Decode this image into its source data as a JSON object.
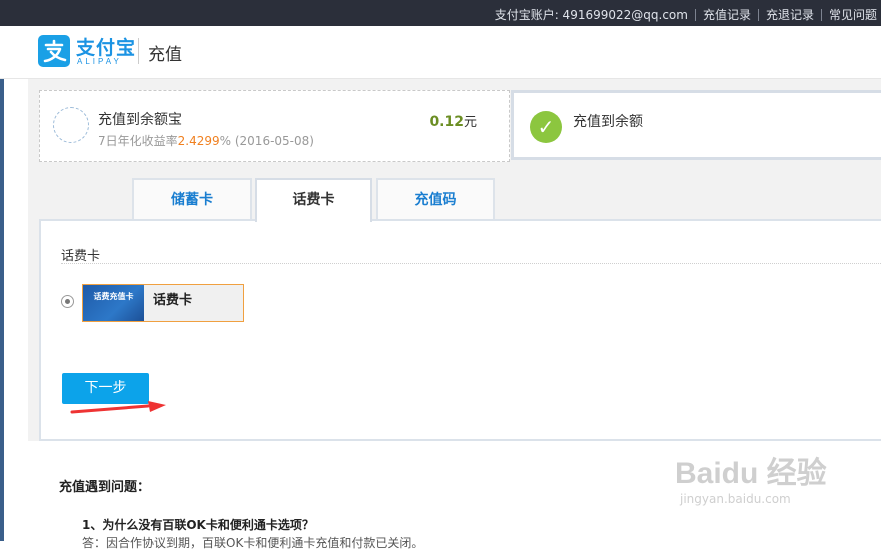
{
  "topbar": {
    "account_label": "支付宝账户: 491699022@qq.com",
    "links": [
      "充值记录",
      "充退记录",
      "常见问题"
    ]
  },
  "header": {
    "logo_cn": "支付宝",
    "logo_en": "ALIPAY",
    "page_title": "充值"
  },
  "options": {
    "yeb": {
      "title": "充值到余额宝",
      "rate_prefix": "7日年化收益率",
      "rate": "2.4299",
      "rate_suffix": "% (2016-05-08)",
      "amount": "0.12",
      "unit": "元"
    },
    "balance": {
      "title": "充值到余额",
      "selected": true
    }
  },
  "tabs": [
    {
      "label": "储蓄卡",
      "active": false
    },
    {
      "label": "话费卡",
      "active": true
    },
    {
      "label": "充值码",
      "active": false
    }
  ],
  "panel": {
    "section_label": "话费卡",
    "card_option": {
      "image_text": "话费充值卡",
      "name": "话费卡",
      "selected": true
    },
    "next_button": "下一步"
  },
  "faq": {
    "title": "充值遇到问题：",
    "q1": "1、为什么没有百联OK卡和便利通卡选项？",
    "a1": "答：因合作协议到期，百联OK卡和便利通卡充值和付款已关闭。"
  },
  "watermark": {
    "text": "Baidu 经验",
    "url": "jingyan.baidu.com"
  },
  "colors": {
    "accent": "#0ca3ea",
    "topbar": "#2b2f3a",
    "rate": "#f08020",
    "amount": "#6b8e23",
    "check": "#8cc63f"
  }
}
